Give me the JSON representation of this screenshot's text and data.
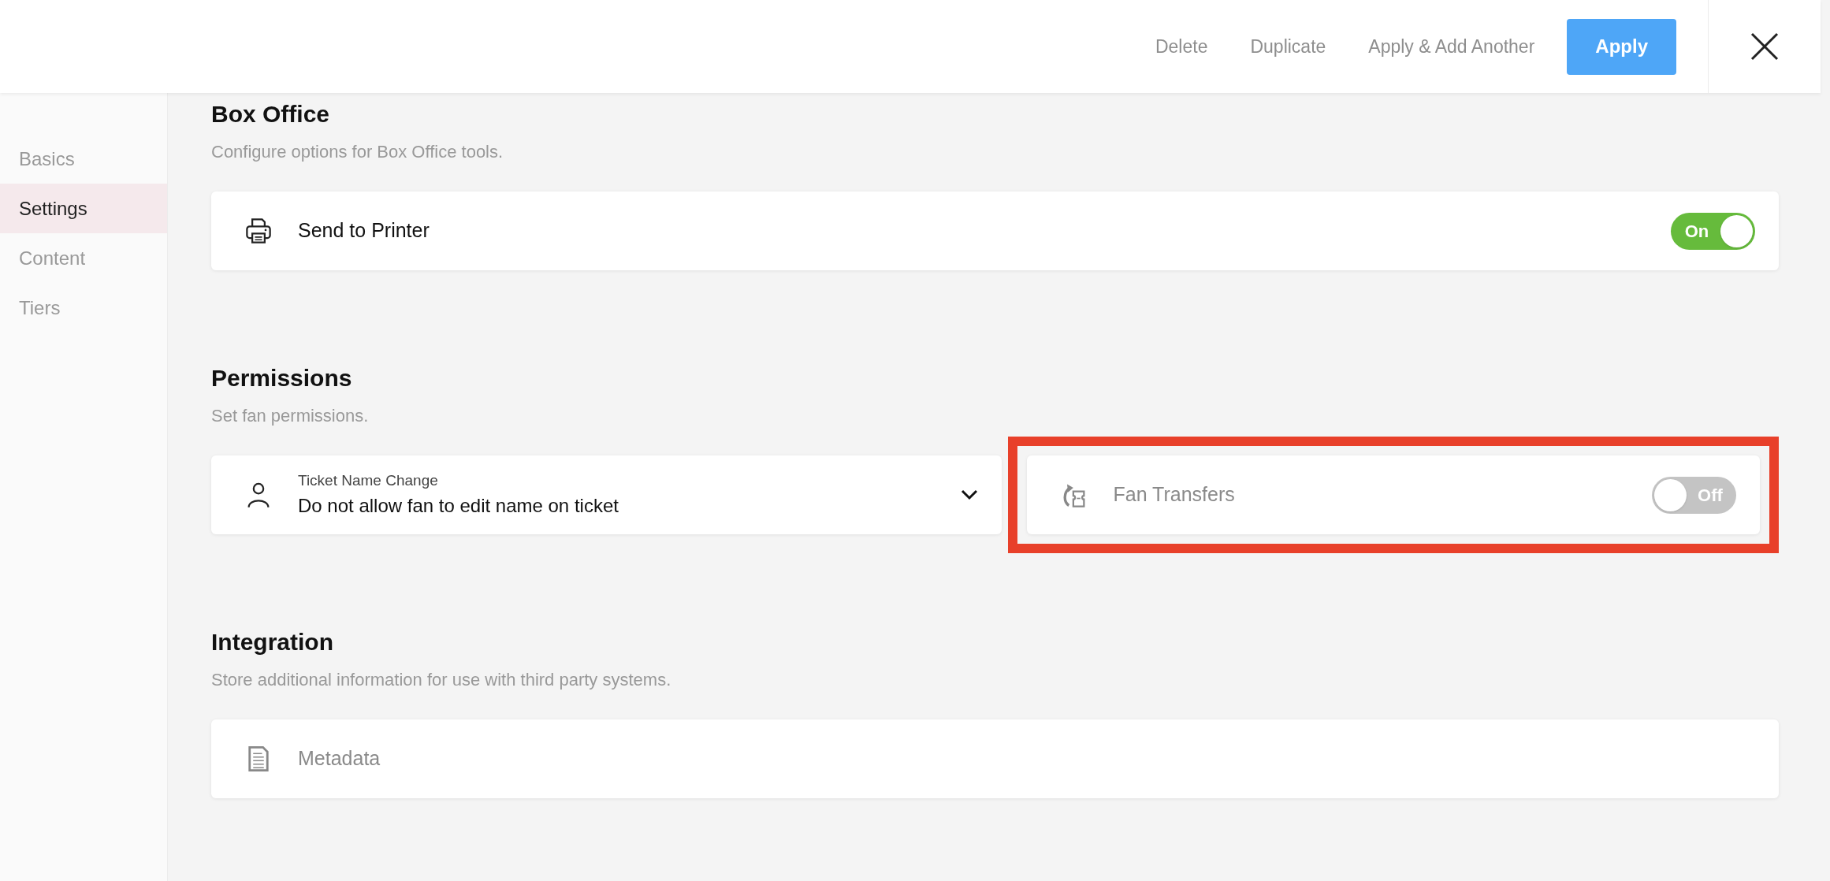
{
  "toolbar": {
    "actions": [
      {
        "label": "Delete",
        "kind": "link"
      },
      {
        "label": "Duplicate",
        "kind": "link"
      },
      {
        "label": "Apply & Add Another",
        "kind": "link"
      },
      {
        "label": "Apply",
        "kind": "primary"
      }
    ]
  },
  "sidebar": {
    "items": [
      {
        "label": "Basics",
        "selected": false
      },
      {
        "label": "Settings",
        "selected": true
      },
      {
        "label": "Content",
        "selected": false
      },
      {
        "label": "Tiers",
        "selected": false
      }
    ]
  },
  "sections": [
    {
      "title": "Box Office",
      "subtitle": "Configure options for Box Office tools.",
      "items": [
        {
          "kind": "toggle",
          "label": "Send to Printer",
          "disabled": false,
          "highlighted": false,
          "on": true,
          "toggle_label": "On"
        }
      ]
    },
    {
      "title": "Permissions",
      "subtitle": "Set fan permissions.",
      "items": [
        {
          "kind": "select",
          "label": "Ticket Name Change",
          "value": "Do not allow fan to edit name on ticket",
          "highlighted": false
        },
        {
          "kind": "toggle",
          "label": "Fan Transfers",
          "disabled": true,
          "highlighted": true,
          "on": false,
          "toggle_label": "Off"
        }
      ]
    },
    {
      "title": "Integration",
      "subtitle": "Store additional information for use with third party systems.",
      "items": [
        {
          "kind": "link",
          "label": "Metadata",
          "disabled": true,
          "highlighted": false
        }
      ]
    }
  ]
}
